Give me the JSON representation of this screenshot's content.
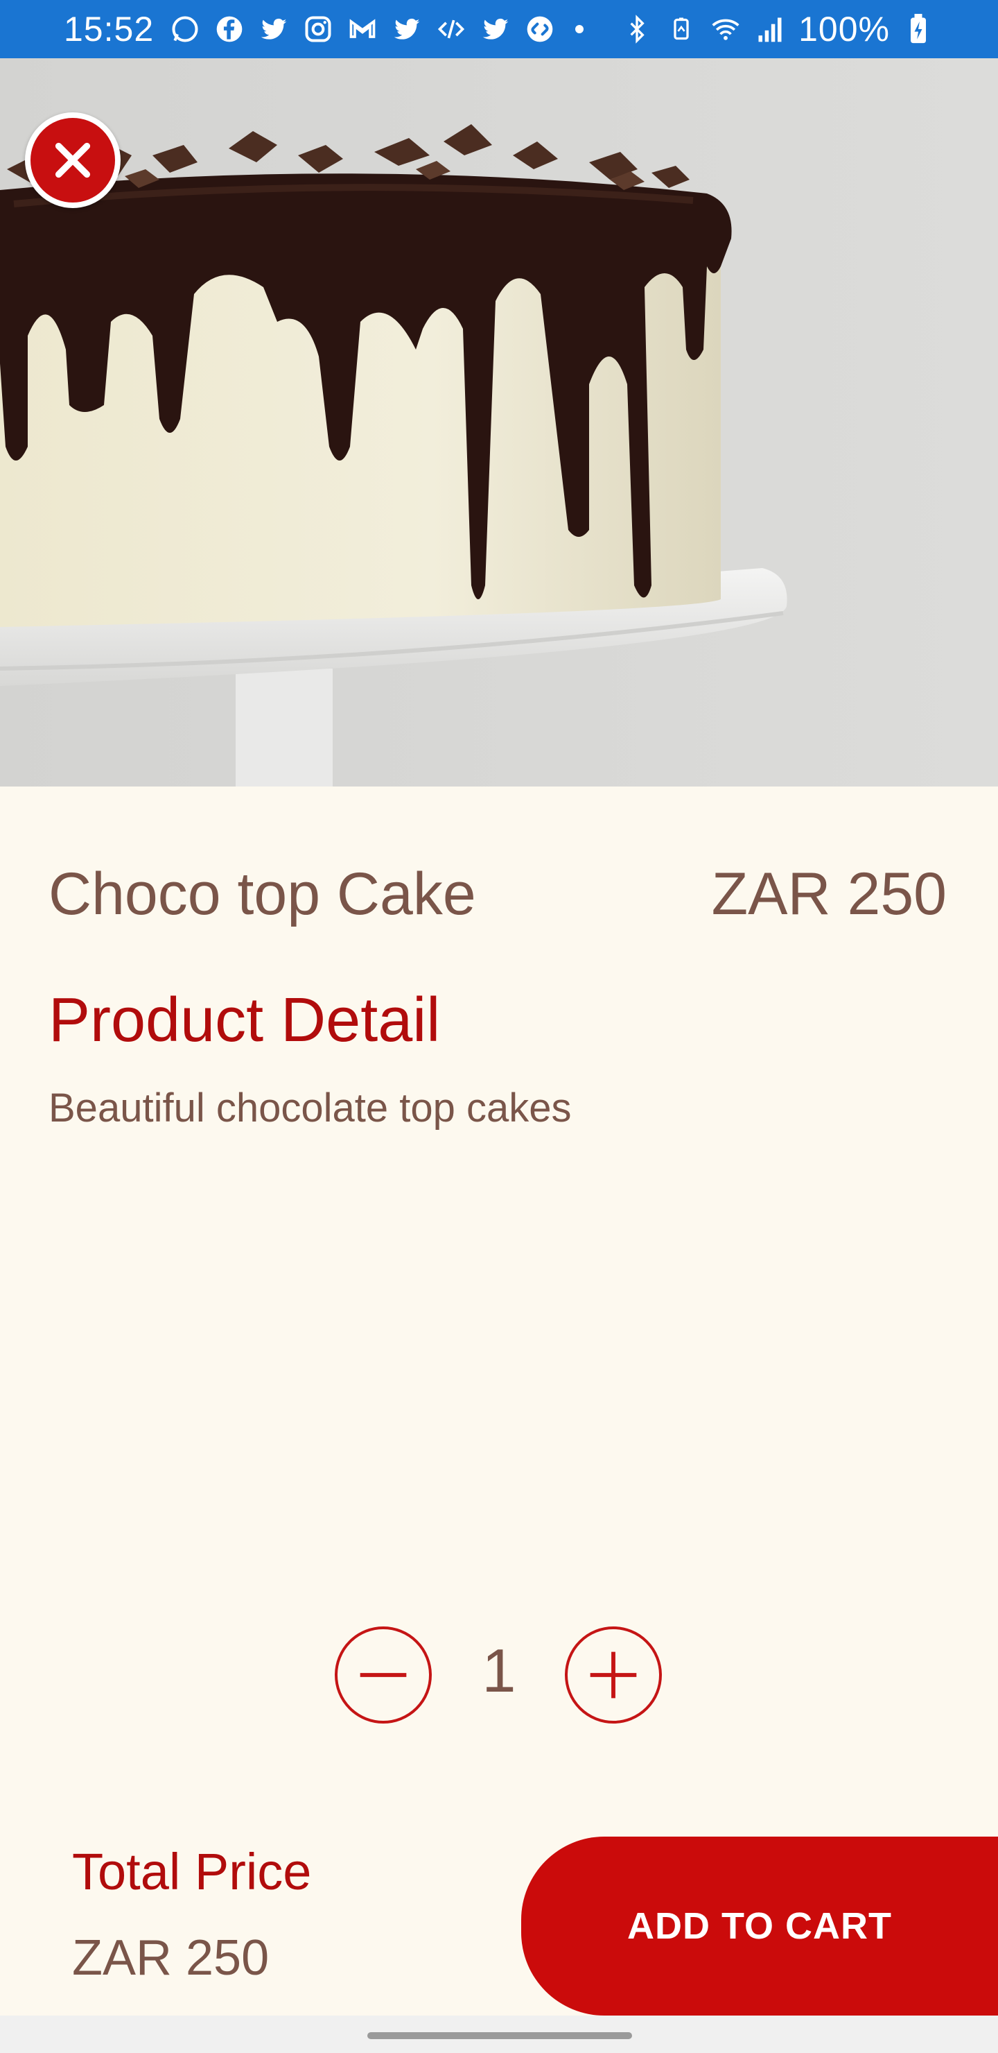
{
  "status_bar": {
    "time": "15:52",
    "battery": "100%",
    "notification_icons": [
      "whatsapp-icon",
      "facebook-icon",
      "twitter-icon",
      "instagram-icon",
      "gmail-icon",
      "twitter-icon",
      "code-icon",
      "twitter-icon",
      "shazam-icon"
    ],
    "system_icons": [
      "bluetooth-icon",
      "battery-saver-icon",
      "wifi-icon",
      "signal-icon",
      "battery-charging-icon"
    ]
  },
  "product": {
    "name": "Choco top Cake",
    "price": "ZAR 250",
    "detail_heading": "Product Detail",
    "description": "Beautiful chocolate top cakes",
    "image": "chocolate-drip-cake-photo"
  },
  "quantity": {
    "value": "1",
    "minus_icon": "minus-circle-icon",
    "plus_icon": "plus-circle-icon"
  },
  "footer": {
    "total_label": "Total Price",
    "total_value": "ZAR 250",
    "add_to_cart_label": "ADD TO CART"
  },
  "colors": {
    "status_bar": "#1a75d2",
    "accent_red": "#cb0b0b",
    "heading_red": "#b10c0c",
    "text_brown": "#7a5549",
    "background": "#fdf9ef"
  }
}
